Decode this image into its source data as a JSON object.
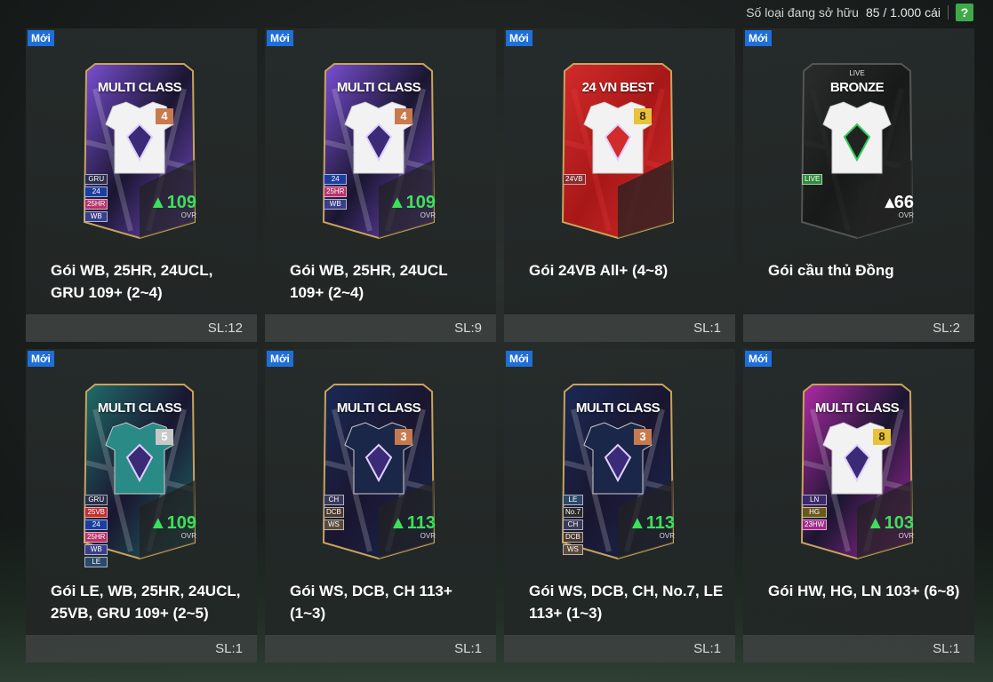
{
  "header": {
    "owned_label": "Số loại đang sở hữu",
    "owned_count": "85 / 1.000 cái",
    "help_label": "?"
  },
  "packs": [
    {
      "badge": "Mới",
      "card_title": "MULTI CLASS",
      "card_sub": "",
      "grade": "4",
      "tags": [
        "GRU",
        "24",
        "25HR",
        "WB"
      ],
      "ovr": "109",
      "ovr_label": "OVR",
      "name": "Gói WB, 25HR, 24UCL, GRU 109+ (2~4)",
      "qty": "SL:12"
    },
    {
      "badge": "Mới",
      "card_title": "MULTI CLASS",
      "card_sub": "",
      "grade": "4",
      "tags": [
        "24",
        "25HR",
        "WB"
      ],
      "ovr": "109",
      "ovr_label": "OVR",
      "name": "Gói WB, 25HR, 24UCL 109+ (2~4)",
      "qty": "SL:9"
    },
    {
      "badge": "Mới",
      "card_title": "24 VN BEST",
      "card_sub": "",
      "grade": "8",
      "tags": [
        "24VB"
      ],
      "ovr": "",
      "ovr_label": "",
      "name": "Gói 24VB All+ (4~8)",
      "qty": "SL:1"
    },
    {
      "badge": "Mới",
      "card_title": "BRONZE",
      "card_sub": "LIVE",
      "grade": "",
      "tags": [
        "LIVE"
      ],
      "ovr": "66",
      "ovr_label": "OVR",
      "name": "Gói cầu thủ Đồng",
      "qty": "SL:2"
    },
    {
      "badge": "Mới",
      "card_title": "MULTI CLASS",
      "card_sub": "",
      "grade": "5",
      "tags": [
        "GRU",
        "25VB",
        "24",
        "25HR",
        "WB",
        "LE"
      ],
      "ovr": "109",
      "ovr_label": "OVR",
      "name": "Gói LE, WB, 25HR, 24UCL, 25VB, GRU 109+ (2~5)",
      "qty": "SL:1"
    },
    {
      "badge": "Mới",
      "card_title": "MULTI CLASS",
      "card_sub": "",
      "grade": "3",
      "tags": [
        "CH",
        "DCB",
        "WS"
      ],
      "ovr": "113",
      "ovr_label": "OVR",
      "name": "Gói WS, DCB, CH 113+ (1~3)",
      "qty": "SL:1"
    },
    {
      "badge": "Mới",
      "card_title": "MULTI CLASS",
      "card_sub": "",
      "grade": "3",
      "tags": [
        "LE",
        "No.7",
        "CH",
        "DCB",
        "WS"
      ],
      "ovr": "113",
      "ovr_label": "OVR",
      "name": "Gói WS, DCB, CH, No.7, LE 113+ (1~3)",
      "qty": "SL:1"
    },
    {
      "badge": "Mới",
      "card_title": "MULTI CLASS",
      "card_sub": "",
      "grade": "8",
      "tags": [
        "LN",
        "HG",
        "23HW"
      ],
      "ovr": "103",
      "ovr_label": "OVR",
      "name": "Gói HW, HG, LN 103+ (6~8)",
      "qty": "SL:1"
    }
  ],
  "theme": {
    "badge_color": "#1e6fd9",
    "help_color": "#3fa94a",
    "ovr_color": "#3ee05a",
    "card_colors": [
      "#7b4fd6",
      "#7b4fd6",
      "#d22b2b",
      "#2a2d2c",
      "#1f6e6a",
      "#1a2a55",
      "#1a2a55",
      "#b02aa8"
    ],
    "card_icons": [
      "multiclass-shield-icon",
      "multiclass-shield-icon",
      "vn-star-icon",
      "live-icon",
      "multiclass-star-icon",
      "multiclass-wings-icon",
      "multiclass-wings-icon",
      "multiclass-hw-icon"
    ]
  }
}
